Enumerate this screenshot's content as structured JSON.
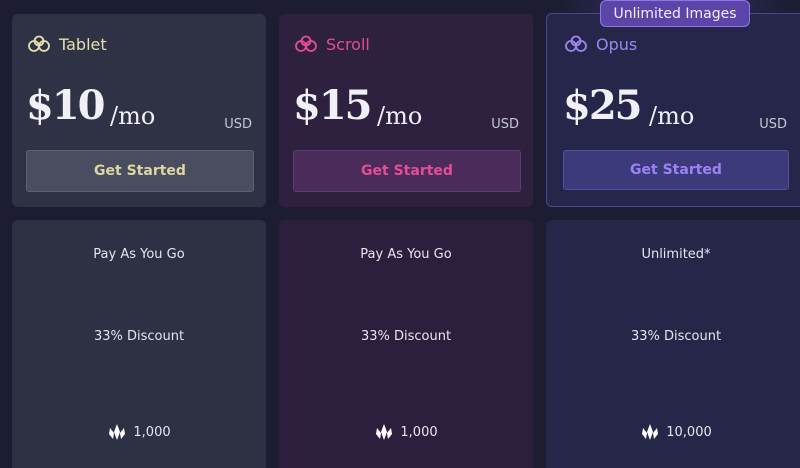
{
  "plans": [
    {
      "name": "Tablet",
      "price": "$10",
      "period": "/mo",
      "currency": "USD",
      "cta": "Get Started",
      "features": [
        "Pay As You Go",
        "33% Discount",
        "1,000"
      ],
      "accent": "#e4dfb0"
    },
    {
      "name": "Scroll",
      "price": "$15",
      "period": "/mo",
      "currency": "USD",
      "cta": "Get Started",
      "features": [
        "Pay As You Go",
        "33% Discount",
        "1,000"
      ],
      "accent": "#e54c96"
    },
    {
      "name": "Opus",
      "price": "$25",
      "period": "/mo",
      "currency": "USD",
      "cta": "Get Started",
      "features": [
        "Unlimited*",
        "33% Discount",
        "10,000"
      ],
      "accent": "#9b86f0",
      "badge": "Unlimited Images"
    }
  ],
  "icons": {
    "plan_logo": "cloud-knot-icon",
    "credits": "gem-icon"
  }
}
